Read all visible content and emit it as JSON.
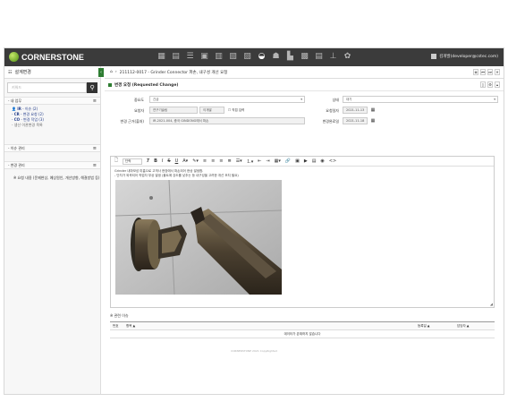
{
  "header": {
    "logo_text": "CORNERSTONE",
    "user": "김개발(developer@cstec.com)",
    "menu_icons": [
      "grid-icon",
      "doc-icon",
      "list-icon",
      "folder-icon",
      "calendar-icon",
      "board-icon",
      "archive-icon",
      "gauge-icon",
      "person-icon",
      "building-icon",
      "chat-icon",
      "doc2-icon",
      "tree-icon",
      "gear-icon"
    ]
  },
  "sidebar": {
    "title": "설계변경",
    "search_placeholder": "키워드",
    "sections": [
      {
        "title": "내 업무",
        "items": [
          {
            "prefix": "IR",
            "text": " - 이슈 (2)"
          },
          {
            "prefix": "CR",
            "text": " - 변경 요청 (2)"
          },
          {
            "prefix": "CO",
            "text": " - 변경 작업 (3)"
          },
          {
            "prefix": "",
            "text": "생산 이관변경 목록"
          }
        ]
      },
      {
        "title": "이슈 관리",
        "items": []
      },
      {
        "title": "변경 관리",
        "items": []
      }
    ]
  },
  "breadcrumb": "211112-0017 - Grinder Connector 파손, 내구성 개선 요청",
  "panel_title": "변경 요청 (Requested Change)",
  "form": {
    "importance_label": "중요도",
    "importance_value": "긴급",
    "status_label": "상태",
    "status_value": "대기",
    "requester_label": "요청자",
    "requester_value": "연구기술팀",
    "requester_name": "이개발",
    "direct_input": "직접 입력",
    "request_date_label": "요청일자",
    "request_date_value": "2021-11-13",
    "basis_label": "변경 근거(출처)",
    "basis_value": "IR-2021-004, 중국 GINDONG에서 파손",
    "complete_date_label": "변경완료일",
    "complete_date_value": "2021-11-18"
  },
  "content_label": "요청 내용 (문제현상, 예상원인, 개선방향, 해결방법 등)",
  "editor": {
    "font_select": "단락",
    "lines": [
      "Grinder 내마모성 미흡으로 고객사 현장에서 파손되어 현상 발생함.",
      "- 단차가 외곽되어 작업자 부상 발생 (볼트에 강도를 낮추는 등 내구성을 고려한 개선 조치 필요)"
    ]
  },
  "related": {
    "label": "관련 이슈",
    "columns": [
      "번호",
      "항목 ▲",
      "등록일 ▲",
      "담당자 ▲"
    ],
    "empty_text": "데이터가 존재하지 않습니다"
  },
  "footer": "CORNERSTONE 2021 CopyRighted"
}
